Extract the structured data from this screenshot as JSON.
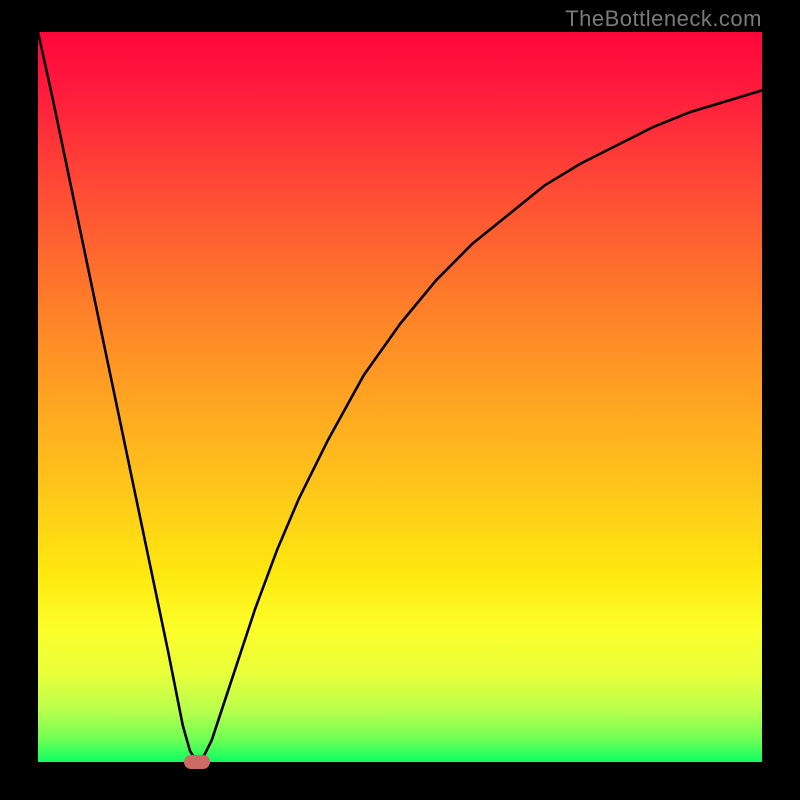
{
  "watermark": "TheBottleneck.com",
  "marker": {
    "color": "#cc6a64"
  },
  "chart_data": {
    "type": "line",
    "title": "",
    "xlabel": "",
    "ylabel": "",
    "xlim": [
      0,
      100
    ],
    "ylim": [
      0,
      100
    ],
    "grid": false,
    "series": [
      {
        "name": "curve",
        "x": [
          0,
          2,
          4,
          6,
          8,
          10,
          12,
          14,
          16,
          18,
          20,
          21,
          22,
          23,
          24,
          25,
          26,
          28,
          30,
          33,
          36,
          40,
          45,
          50,
          55,
          60,
          65,
          70,
          75,
          80,
          85,
          90,
          95,
          100
        ],
        "values": [
          100,
          91,
          81.5,
          72,
          62.5,
          53,
          43.5,
          34,
          24.5,
          15,
          5,
          1.5,
          0,
          1,
          3,
          6,
          9,
          15,
          21,
          29,
          36,
          44,
          53,
          60,
          66,
          71,
          75,
          79,
          82,
          84.5,
          87,
          89,
          90.5,
          92
        ]
      }
    ],
    "marker_point": {
      "x": 22,
      "y": 0
    },
    "background_gradient": {
      "top": "#ff063a",
      "bottom": "#0cff62",
      "stops": [
        "red",
        "orange",
        "yellow",
        "green"
      ]
    }
  }
}
